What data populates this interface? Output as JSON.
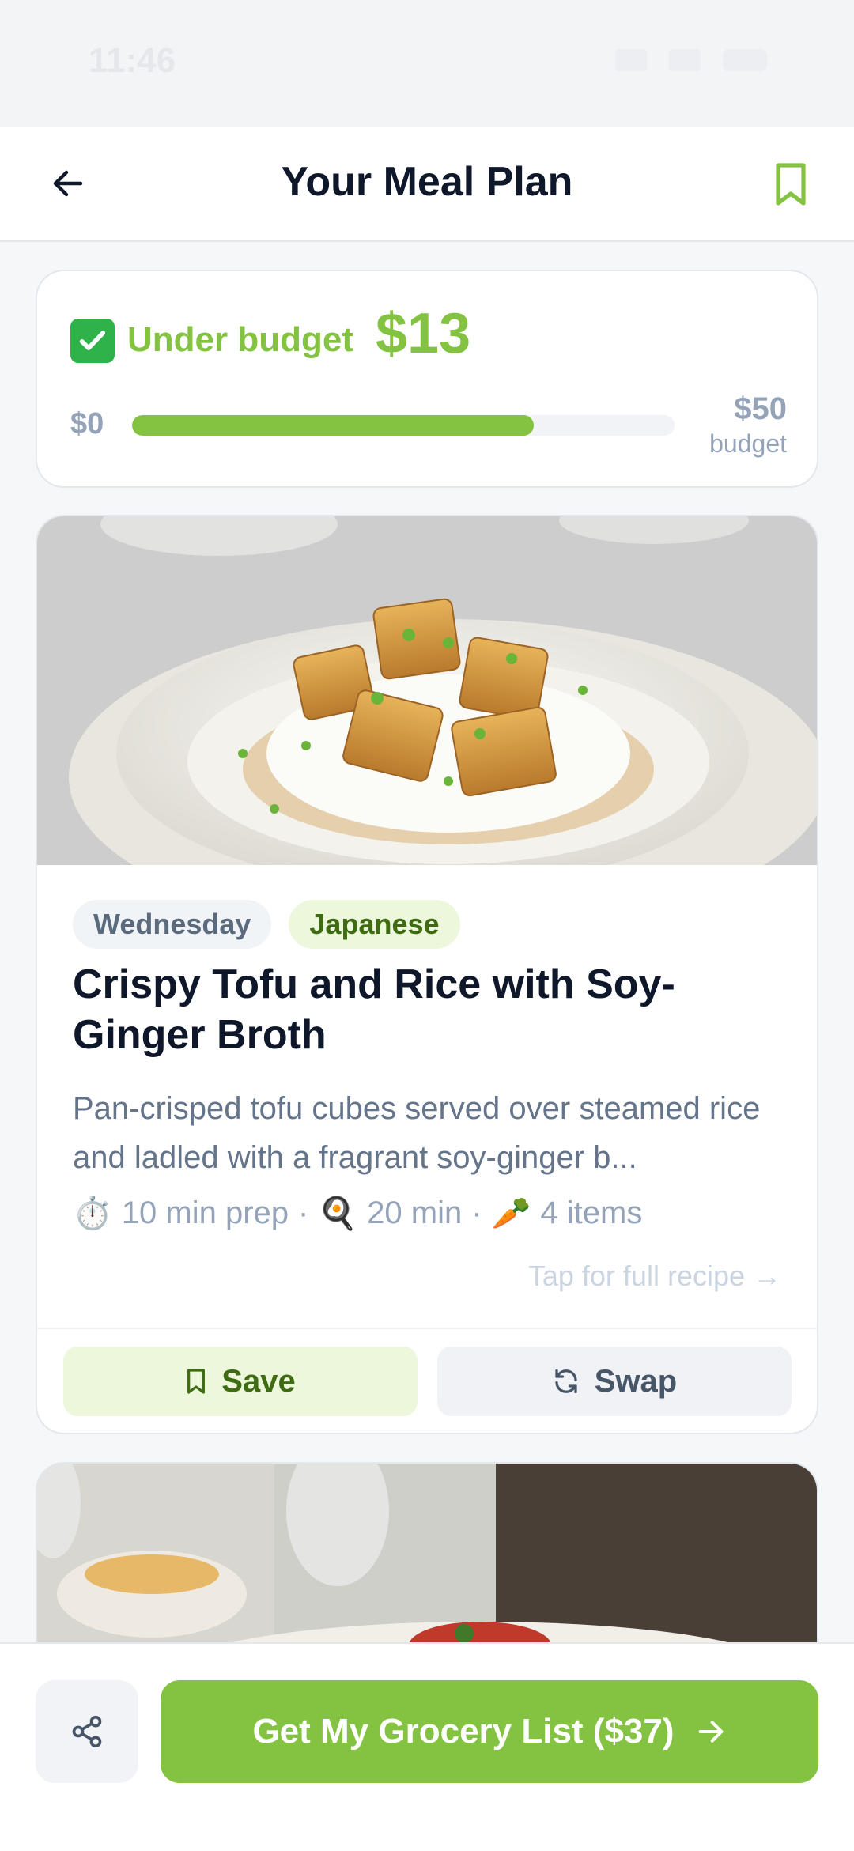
{
  "status_bar": {
    "time": "11:46"
  },
  "header": {
    "title": "Your Meal Plan"
  },
  "budget": {
    "status_label": "Under budget",
    "amount_under": "$13",
    "range_min": "$0",
    "range_max": "$50",
    "range_max_sub": "budget",
    "progress_fraction": 0.74,
    "check_icon": "check-square-icon"
  },
  "meal": {
    "day_tag": "Wednesday",
    "cuisine_tag": "Japanese",
    "title": "Crispy Tofu and Rice with Soy-Ginger Broth",
    "description": "Pan-crisped tofu cubes served over steamed rice and ladled with a fragrant soy-ginger b...",
    "prep_icon": "⏱️",
    "prep": "10 min prep",
    "cook_icon": "🍳",
    "cook": "20 min",
    "items_icon": "🥕",
    "items": "4 items",
    "separator": "·",
    "recipe_link": "Tap for full recipe →",
    "save_label": "Save",
    "swap_label": "Swap"
  },
  "cta": {
    "label": "Get My Grocery List ($37)"
  },
  "colors": {
    "accent": "#84c341",
    "accent_light": "#ecf7dc",
    "text_dark": "#0f172a",
    "muted": "#64748b"
  }
}
